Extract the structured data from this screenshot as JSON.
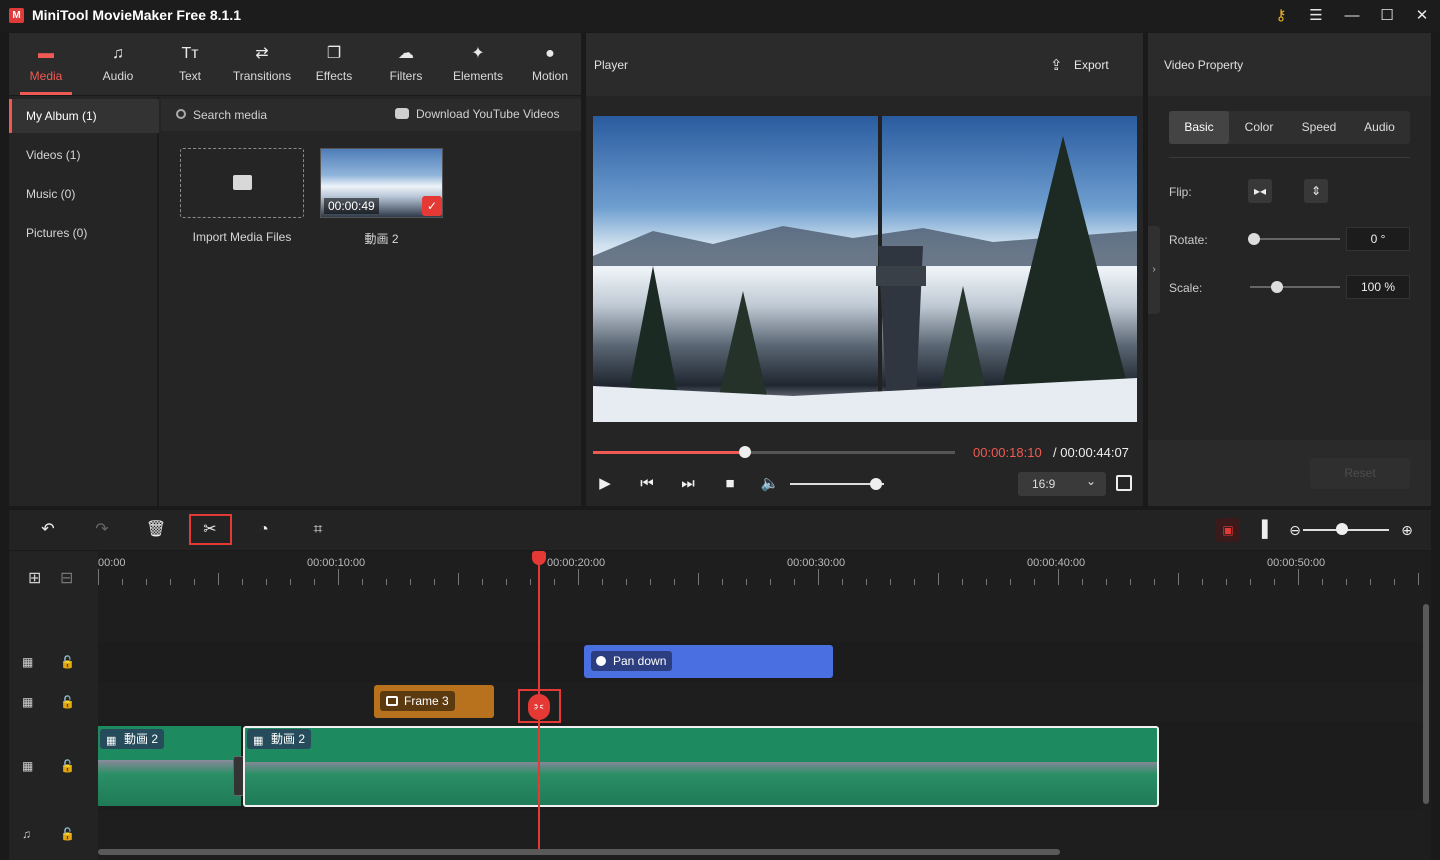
{
  "app": {
    "title": "MiniTool MovieMaker Free 8.1.1"
  },
  "window": {
    "key_icon": "key-icon",
    "menu_icon": "hamburger-icon",
    "minimize": "—",
    "maximize": "☐",
    "close": "✕"
  },
  "media_tabs": [
    {
      "label": "Media",
      "icon": "▬",
      "active": true
    },
    {
      "label": "Audio",
      "icon": "♫"
    },
    {
      "label": "Text",
      "icon": "Tт"
    },
    {
      "label": "Transitions",
      "icon": "⇄"
    },
    {
      "label": "Effects",
      "icon": "❐"
    },
    {
      "label": "Filters",
      "icon": "☁"
    },
    {
      "label": "Elements",
      "icon": "✦"
    },
    {
      "label": "Motion",
      "icon": "●"
    }
  ],
  "sidebar": {
    "items": [
      {
        "label": "My Album (1)",
        "active": true
      },
      {
        "label": "Videos (1)"
      },
      {
        "label": "Music (0)"
      },
      {
        "label": "Pictures (0)"
      }
    ]
  },
  "media": {
    "search_placeholder": "Search media",
    "youtube_label": "Download YouTube Videos",
    "import_label": "Import Media Files",
    "clip": {
      "duration": "00:00:49",
      "label": "動画 2",
      "selected": true
    }
  },
  "player": {
    "title": "Player",
    "export_label": "Export",
    "time_current": "00:00:18:10",
    "time_total": " / 00:00:44:07",
    "progress_fraction": 0.42,
    "volume_fraction": 0.92,
    "aspect_ratio": "16:9"
  },
  "property": {
    "title": "Video Property",
    "tabs": [
      {
        "label": "Basic",
        "active": true
      },
      {
        "label": "Color"
      },
      {
        "label": "Speed"
      },
      {
        "label": "Audio"
      }
    ],
    "flip_label": "Flip:",
    "rotate_label": "Rotate:",
    "rotate_value": "0 °",
    "rotate_fraction": 0.0,
    "scale_label": "Scale:",
    "scale_value": "100 %",
    "scale_fraction": 0.25,
    "reset_label": "Reset"
  },
  "timeline": {
    "ruler_labels": [
      "00:00",
      "00:00:10:00",
      "00:00:20:00",
      "00:00:30:00",
      "00:00:40:00",
      "00:00:50:00"
    ],
    "playhead_time": "00:00:18:10",
    "zoom_fraction": 0.45,
    "caption_clip": {
      "label": "Pan down"
    },
    "frame_clip": {
      "label": "Frame 3"
    },
    "video_clips": [
      {
        "label": "動画 2"
      },
      {
        "label": "動画 2"
      }
    ]
  },
  "colors": {
    "accent": "#ef5a52",
    "caption_clip": "#4a6fe0",
    "frame_clip": "#b8721d",
    "audio_wave": "#1e8a60",
    "highlight": "#e53935"
  }
}
